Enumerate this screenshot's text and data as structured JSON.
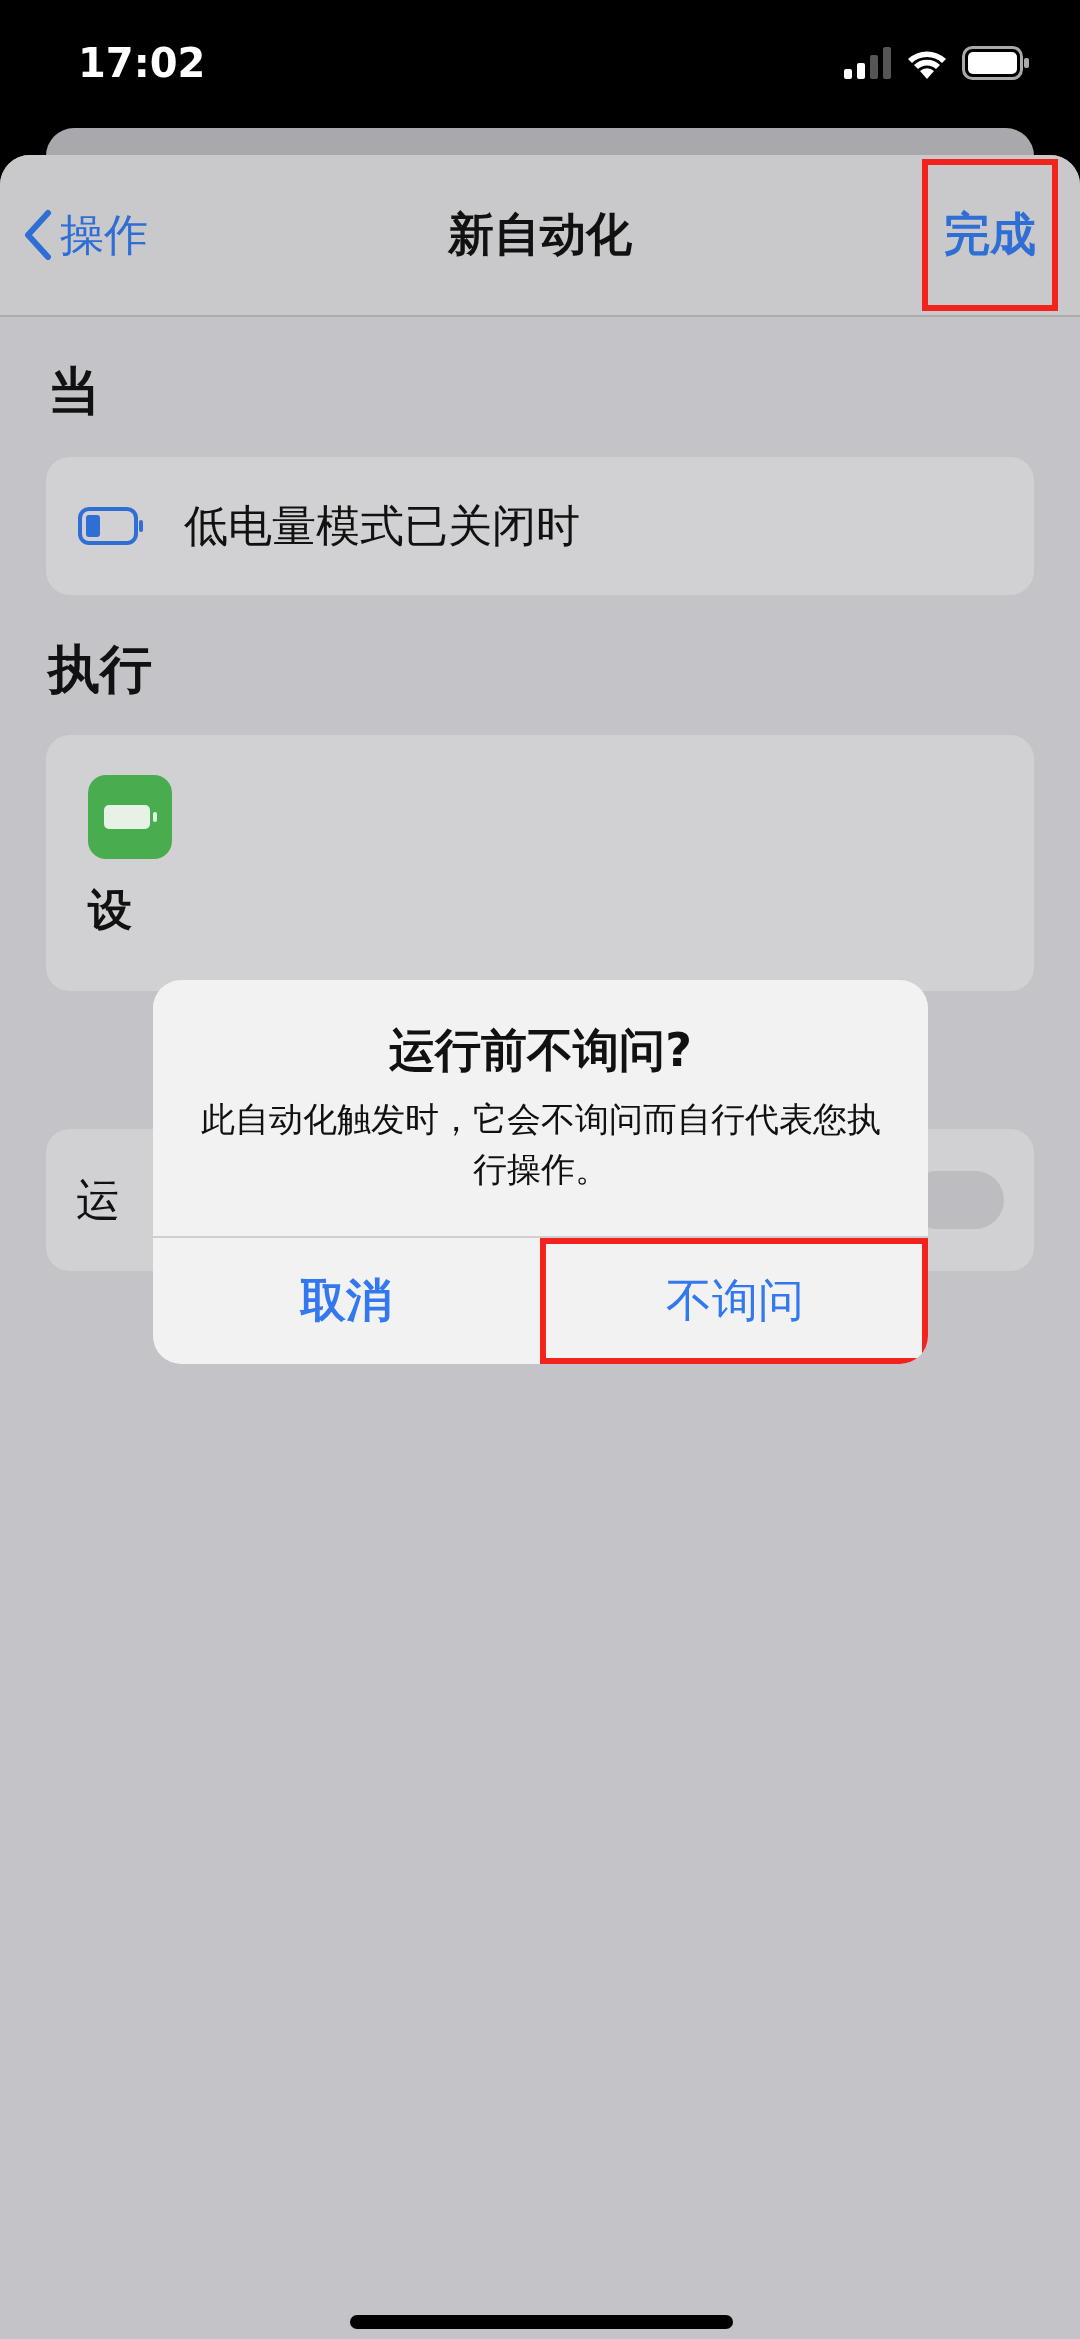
{
  "status_bar": {
    "time": "17:02"
  },
  "nav": {
    "back": "操作",
    "title": "新自动化",
    "done": {
      "label": "完成",
      "highlighted": true
    }
  },
  "sections": [
    {
      "header": "当",
      "kind": "trigger",
      "text": "低电量模式已关闭时"
    },
    {
      "header": "执行",
      "kind": "action",
      "text": "设"
    },
    {
      "kind": "toggle",
      "text": "运",
      "on": false
    }
  ],
  "alert": {
    "title": "运行前不询问?",
    "message": "此自动化触发时，它会不询问而自行代表您执行操作。",
    "buttons": [
      {
        "label": "取消",
        "bold": true,
        "highlighted": false
      },
      {
        "label": "不询问",
        "bold": false,
        "highlighted": true
      }
    ]
  }
}
